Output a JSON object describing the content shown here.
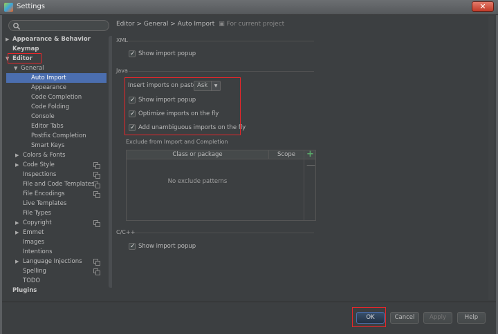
{
  "window": {
    "title": "Settings",
    "close_glyph": "✕"
  },
  "search": {
    "placeholder": ""
  },
  "sidebar": {
    "items": [
      {
        "label": "Appearance & Behavior",
        "arrow": "▶",
        "bold": true
      },
      {
        "label": "Keymap",
        "bold": true
      },
      {
        "label": "Editor",
        "arrow": "▼",
        "bold": true
      },
      {
        "label": "General",
        "arrow": "▼"
      },
      {
        "label": "Auto Import",
        "selected": true
      },
      {
        "label": "Appearance"
      },
      {
        "label": "Code Completion"
      },
      {
        "label": "Code Folding"
      },
      {
        "label": "Console"
      },
      {
        "label": "Editor Tabs"
      },
      {
        "label": "Postfix Completion"
      },
      {
        "label": "Smart Keys"
      },
      {
        "label": "Colors & Fonts",
        "arrow": "▶"
      },
      {
        "label": "Code Style",
        "arrow": "▶",
        "project": true
      },
      {
        "label": "Inspections",
        "project": true
      },
      {
        "label": "File and Code Templates",
        "project": true
      },
      {
        "label": "File Encodings",
        "project": true
      },
      {
        "label": "Live Templates"
      },
      {
        "label": "File Types"
      },
      {
        "label": "Copyright",
        "arrow": "▶",
        "project": true
      },
      {
        "label": "Emmet",
        "arrow": "▶"
      },
      {
        "label": "Images"
      },
      {
        "label": "Intentions"
      },
      {
        "label": "Language Injections",
        "arrow": "▶",
        "project": true
      },
      {
        "label": "Spelling",
        "project": true
      },
      {
        "label": "TODO"
      },
      {
        "label": "Plugins",
        "bold": true
      }
    ]
  },
  "breadcrumb": {
    "path": "Editor > General > Auto Import",
    "scope_icon": "▣",
    "scope": "For current project"
  },
  "xml": {
    "label": "XML",
    "show_import_popup": "Show import popup"
  },
  "java": {
    "label": "Java",
    "insert_imports_label": "Insert imports on paste:",
    "insert_imports_value": "Ask",
    "combo_arrow": "▼",
    "show_import_popup": "Show import popup",
    "optimize_imports": "Optimize imports on the fly",
    "add_unambiguous": "Add unambiguous imports on the fly"
  },
  "exclude": {
    "label": "Exclude from Import and Completion",
    "col_class": "Class or package",
    "col_scope": "Scope",
    "empty": "No exclude patterns",
    "add": "+",
    "remove": "—"
  },
  "cpp": {
    "label": "C/C++",
    "show_import_popup": "Show import popup"
  },
  "buttons": {
    "ok": "OK",
    "cancel": "Cancel",
    "apply": "Apply",
    "help": "Help"
  },
  "colors": {
    "selection": "#4b6eaf",
    "highlight_box": "#e8262a",
    "add_green": "#59a869"
  }
}
